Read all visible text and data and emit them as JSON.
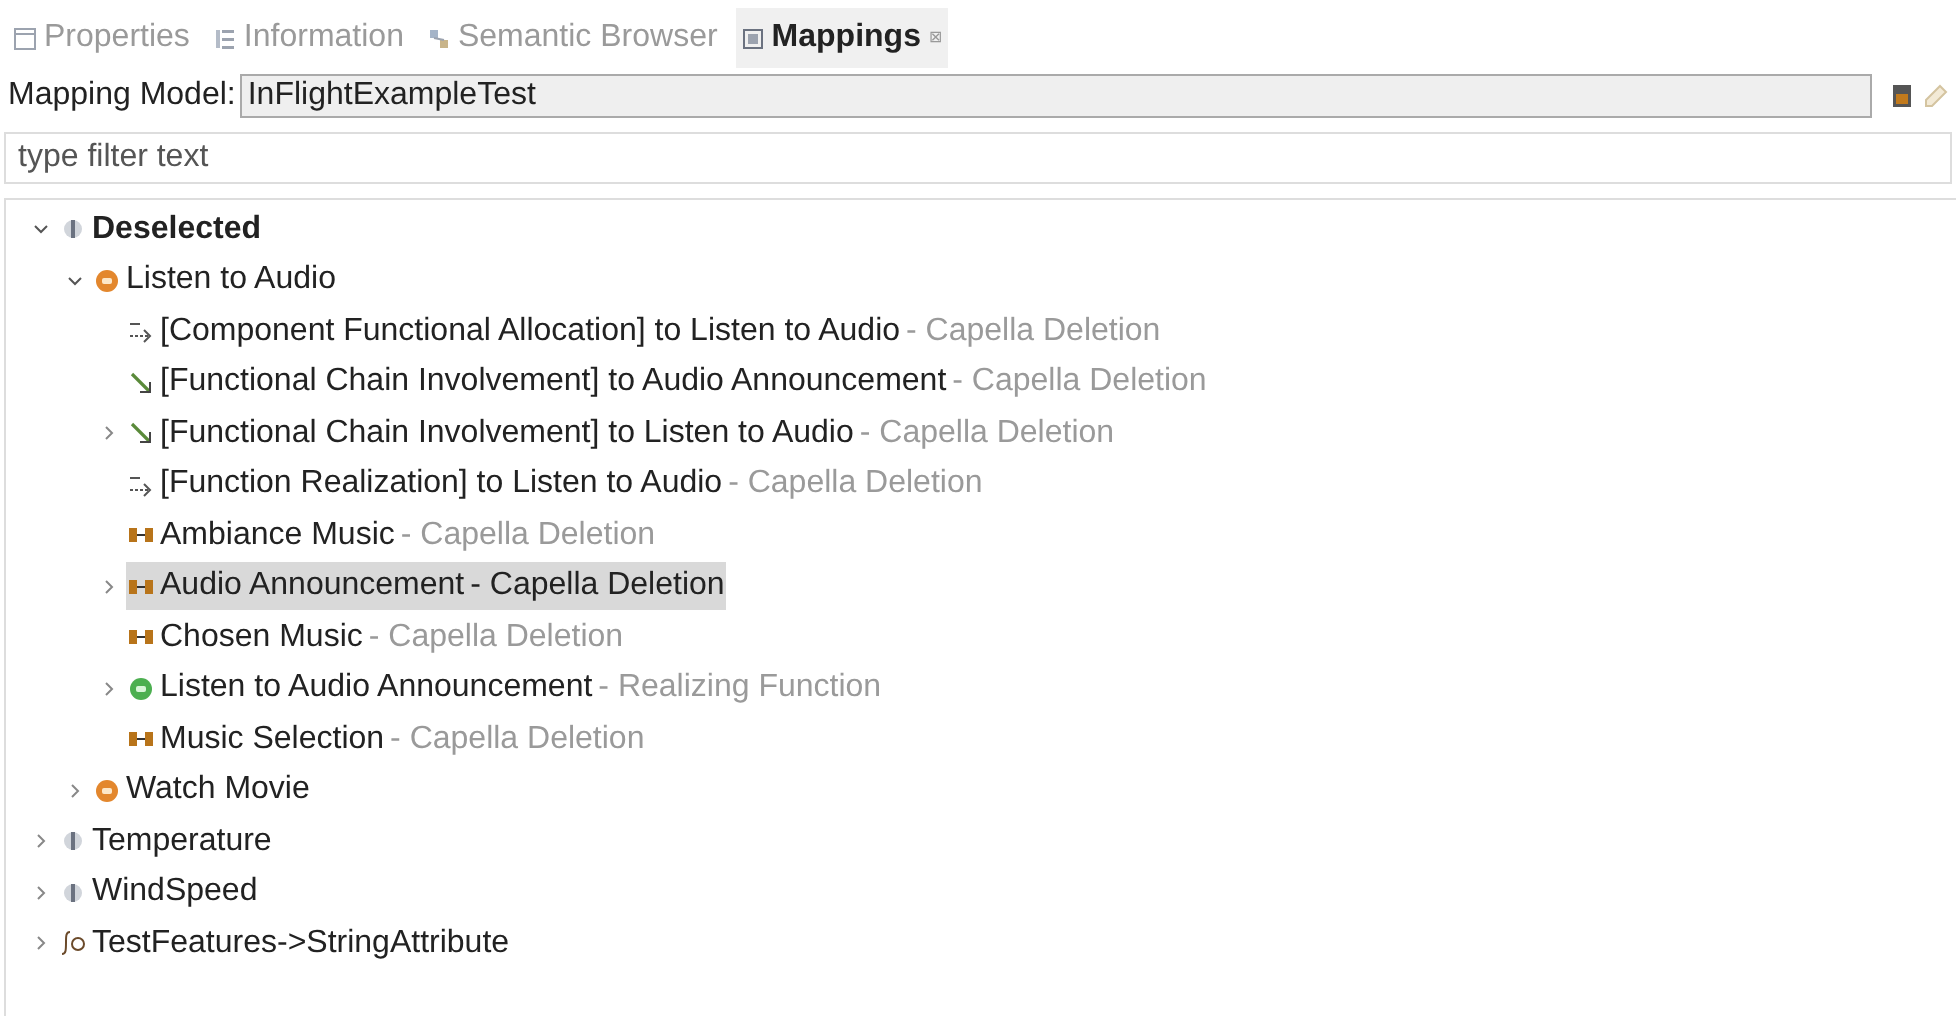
{
  "tabs": [
    {
      "label": "Properties",
      "kind": "properties",
      "selected": false
    },
    {
      "label": "Information",
      "kind": "information",
      "selected": false
    },
    {
      "label": "Semantic Browser",
      "kind": "browser",
      "selected": false
    },
    {
      "label": "Mappings",
      "kind": "mappings",
      "selected": true,
      "close": "⊠"
    }
  ],
  "mapping_model": {
    "label": "Mapping Model:",
    "value": "InFlightExampleTest"
  },
  "filter": {
    "placeholder": "type filter text"
  },
  "tree": [
    {
      "label": "Deselected",
      "kind": "feature",
      "bold": true,
      "expanded": true,
      "selected": false,
      "children": [
        {
          "label": "Listen to Audio",
          "kind": "function",
          "expanded": true,
          "selected": false,
          "children": [
            {
              "label": "[Component Functional Allocation] to Listen to Audio",
              "suffix": "- Capella Deletion",
              "kind": "allocation",
              "selected": false
            },
            {
              "label": "[Functional Chain Involvement] to Audio Announcement",
              "suffix": "- Capella Deletion",
              "kind": "chain",
              "selected": false
            },
            {
              "label": "[Functional Chain Involvement] to Listen to Audio",
              "suffix": "- Capella Deletion",
              "kind": "chain",
              "expanded": false,
              "selected": false
            },
            {
              "label": "[Function Realization] to Listen to Audio",
              "suffix": "- Capella Deletion",
              "kind": "realization",
              "selected": false
            },
            {
              "label": "Ambiance Music",
              "suffix": "- Capella Deletion",
              "kind": "exchange",
              "selected": false
            },
            {
              "label": "Audio Announcement",
              "suffix": "- Capella Deletion",
              "kind": "exchange",
              "expanded": false,
              "selected": true
            },
            {
              "label": "Chosen Music",
              "suffix": "- Capella Deletion",
              "kind": "exchange",
              "selected": false
            },
            {
              "label": "Listen to Audio Announcement",
              "suffix": "- Realizing Function",
              "kind": "function-green",
              "expanded": false,
              "selected": false
            },
            {
              "label": "Music Selection",
              "suffix": "- Capella Deletion",
              "kind": "exchange",
              "selected": false
            }
          ]
        },
        {
          "label": "Watch Movie",
          "kind": "function",
          "expanded": false,
          "selected": false
        }
      ]
    },
    {
      "label": "Temperature",
      "kind": "feature",
      "expanded": false,
      "selected": false
    },
    {
      "label": "WindSpeed",
      "kind": "feature",
      "expanded": false,
      "selected": false
    },
    {
      "label": "TestFeatures->StringAttribute",
      "kind": "attribute",
      "expanded": false,
      "selected": false
    }
  ]
}
